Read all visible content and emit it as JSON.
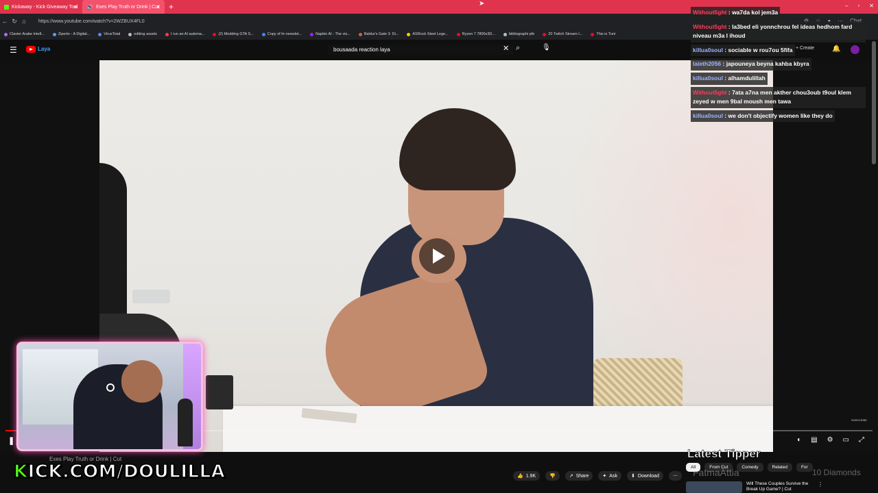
{
  "browser": {
    "tabs": [
      {
        "label": "Kickaway - Kick Giveaway Tool"
      },
      {
        "label": "Exes Play Truth or Drink | Cut"
      }
    ],
    "new_tab_label": "+",
    "window_controls": [
      "–",
      "▫",
      "✕"
    ],
    "url": "https://www.youtube.com/watch?v=2WZBUX4FL0",
    "bookmarks": [
      {
        "label": "Clavier Arabe Intell...",
        "color": "#b36bff"
      },
      {
        "label": "Ziperto - A Digital...",
        "color": "#4aa3ff"
      },
      {
        "label": "VirusTotal",
        "color": "#4f8bff"
      },
      {
        "label": "editing assets",
        "color": "#bbbbbb"
      },
      {
        "label": "I run an AI automa...",
        "color": "#ff3b3b"
      },
      {
        "label": "(2) Modding GTA S...",
        "color": "#ff0033"
      },
      {
        "label": "Copy of hr-newslet...",
        "color": "#4285f4"
      },
      {
        "label": "Napkin AI - The vis...",
        "color": "#a020f0"
      },
      {
        "label": "Baldur's Gate 3: Di...",
        "color": "#cc6633"
      },
      {
        "label": "ASRock Steel Lege...",
        "color": "#ffcc00"
      },
      {
        "label": "Ryzen 7 7800x3D...",
        "color": "#ff0033"
      },
      {
        "label": "bibliographi pfe",
        "color": "#bbbbbb"
      },
      {
        "label": "20 Twitch Stream I...",
        "color": "#ff0033"
      },
      {
        "label": "This is Tuni",
        "color": "#ff0033"
      }
    ]
  },
  "youtube": {
    "search_value": "bousaada reaction laya",
    "create_label": "+ Create",
    "logo_word": "Laya",
    "progress_fraction": 0.01,
    "video_title": "Exes Play Truth or Drink | Cut",
    "like_count": "1.9K",
    "share_label": "Share",
    "ask_label": "Ask",
    "download_label": "Download",
    "chips": [
      {
        "label": "All",
        "selected": true
      },
      {
        "label": "From Cut",
        "selected": false
      },
      {
        "label": "Comedy",
        "selected": false
      },
      {
        "label": "Related",
        "selected": false
      },
      {
        "label": "For",
        "selected": false
      }
    ],
    "recommendation_title": "Will These Couples Survive the Break Up Game? | Cut",
    "watermark": "SUBSCRIBE"
  },
  "chat": {
    "messages": [
      {
        "user": "Without5ght",
        "text": "wa7da kol jem3a",
        "color": "#ff3b5c"
      },
      {
        "user": "Without5ght",
        "text": "la3bed eli yonnchrou fel ideas hedhom fard niveau m3a l ihoud",
        "color": "#ff3b5c"
      },
      {
        "user": "killua0soul",
        "text": "sociable w rou7ou 5fifa",
        "color": "#9db4ff"
      },
      {
        "user": "laieth2056",
        "text": "japouneya beyna kahba kbyra",
        "color": "#9db4ff"
      },
      {
        "user": "killua0soul",
        "text": "alhamdulillah",
        "color": "#9db4ff"
      },
      {
        "user": "Without5ght",
        "text": "7ata a7na men akther chou3oub t9oul klem zeyed w men 9bal moush men tawa",
        "color": "#ff3b5c"
      },
      {
        "user": "killua0soul",
        "text": "we don't objectify women like they do",
        "color": "#9db4ff"
      }
    ],
    "separator": " : ",
    "corner_label": "Chat"
  },
  "overlay": {
    "kick_prefix": "K",
    "kick_rest": "ICK.COM/DOULILLA",
    "latest_tipper_label": "Latest Tipper",
    "tipper_name": "FatmaAttia",
    "tipper_amount": "10 Diamonds"
  },
  "colors": {
    "accent": "#ff0000",
    "kick_green": "#53fc18",
    "tab_bar": "#e0334e"
  }
}
